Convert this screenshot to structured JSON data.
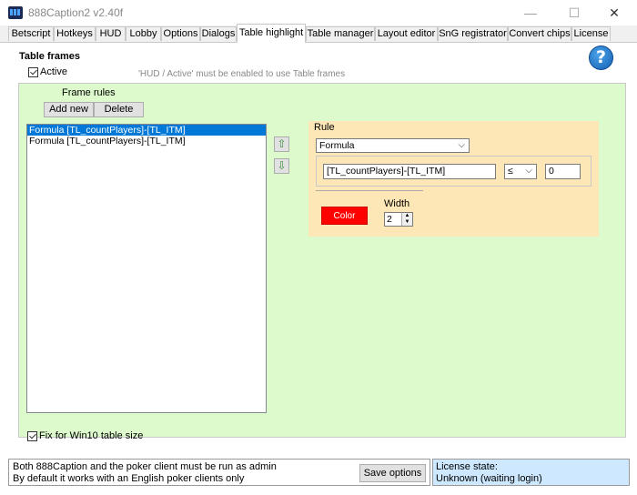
{
  "window": {
    "title": "888Caption2 v2.40f",
    "minimize_glyph": "—",
    "maximize_glyph": "☐",
    "close_glyph": "✕"
  },
  "tabs": [
    {
      "label": "Betscript"
    },
    {
      "label": "Hotkeys"
    },
    {
      "label": "HUD"
    },
    {
      "label": "Lobby"
    },
    {
      "label": "Options"
    },
    {
      "label": "Dialogs"
    },
    {
      "label": "Table highlight",
      "active": true
    },
    {
      "label": "Table manager"
    },
    {
      "label": "Layout editor"
    },
    {
      "label": "SnG registrator"
    },
    {
      "label": "Convert chips"
    },
    {
      "label": "License"
    }
  ],
  "page": {
    "title": "Table frames",
    "active_label": "Active",
    "active_checked": true,
    "hint": "'HUD / Active' must be enabled to use Table frames",
    "help_glyph": "?"
  },
  "frame_rules": {
    "label": "Frame rules",
    "add_label": "Add new",
    "delete_label": "Delete",
    "items": [
      {
        "text": "Formula [TL_countPlayers]-[TL_ITM]",
        "selected": true
      },
      {
        "text": "Formula [TL_countPlayers]-[TL_ITM]",
        "selected": false
      }
    ],
    "move_up_glyph": "⇧",
    "move_down_glyph": "⇩"
  },
  "rule": {
    "label": "Rule",
    "type_value": "Formula",
    "formula_value": "[TL_countPlayers]-[TL_ITM]",
    "operator_value": "≤",
    "threshold_value": "0",
    "color_label": "Color",
    "width_label": "Width",
    "width_value": "2"
  },
  "fix_win10": {
    "label": "Fix for Win10 table size",
    "checked": true
  },
  "status": {
    "line1": "Both 888Caption and the poker client must be run as admin",
    "line2": "By default it works with an English poker clients only",
    "save_label": "Save options",
    "license_label": "License state:",
    "license_value": "Unknown (waiting login)"
  },
  "colors": {
    "panel_green": "#ddfacc",
    "rule_panel": "#fde7b7",
    "selection": "#0078d7",
    "color_swatch": "#ff0000",
    "license_bg": "#cde8ff"
  }
}
